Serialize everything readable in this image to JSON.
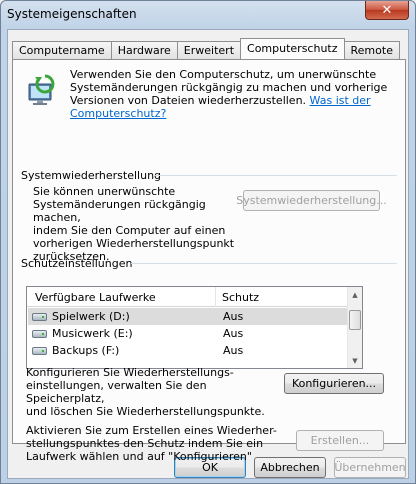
{
  "window": {
    "title": "Systemeigenschaften",
    "close_glyph": "✕"
  },
  "tabs": [
    {
      "label": "Computername",
      "active": false
    },
    {
      "label": "Hardware",
      "active": false
    },
    {
      "label": "Erweitert",
      "active": false
    },
    {
      "label": "Computerschutz",
      "active": true
    },
    {
      "label": "Remote",
      "active": false
    }
  ],
  "intro": {
    "text": "Verwenden Sie den Computerschutz, um unerwünschte Systemänderungen rückgängig zu machen und vorherige Versionen von Dateien wiederherzustellen.",
    "link": "Was ist der Computerschutz?"
  },
  "restore": {
    "title": "Systemwiederherstellung",
    "desc_lines": [
      "Sie können unerwünschte",
      "Systemänderungen rückgängig machen,",
      "indem Sie den Computer auf einen",
      "vorherigen Wiederherstellungspunkt",
      "zurücksetzen."
    ],
    "button": "Systemwiederherstellung..."
  },
  "protection": {
    "title": "Schutzeinstellungen",
    "columns": [
      "Verfügbare Laufwerke",
      "Schutz"
    ],
    "drives": [
      {
        "name": "Spielwerk (D:)",
        "protection": "Aus",
        "selected": true,
        "icon": "drive-icon"
      },
      {
        "name": "Musicwerk (E:)",
        "protection": "Aus",
        "selected": false,
        "icon": "drive-icon"
      },
      {
        "name": "Backups (F:)",
        "protection": "Aus",
        "selected": false,
        "icon": "drive-icon"
      }
    ],
    "configure_lines": [
      "Konfigurieren Sie Wiederherstellungs-",
      "einstellungen, verwalten Sie den Speicherplatz,",
      "und löschen Sie Wiederherstellungspunkte."
    ],
    "configure_button": "Konfigurieren...",
    "create_lines": [
      "Aktivieren Sie zum Erstellen eines Wiederher-",
      "stellungspunktes den Schutz indem Sie ein",
      "Laufwerk wählen und auf \"Konfigurieren\""
    ],
    "create_button": "Erstellen..."
  },
  "buttons": {
    "ok": "OK",
    "cancel": "Abbrechen",
    "apply": "Übernehmen"
  }
}
